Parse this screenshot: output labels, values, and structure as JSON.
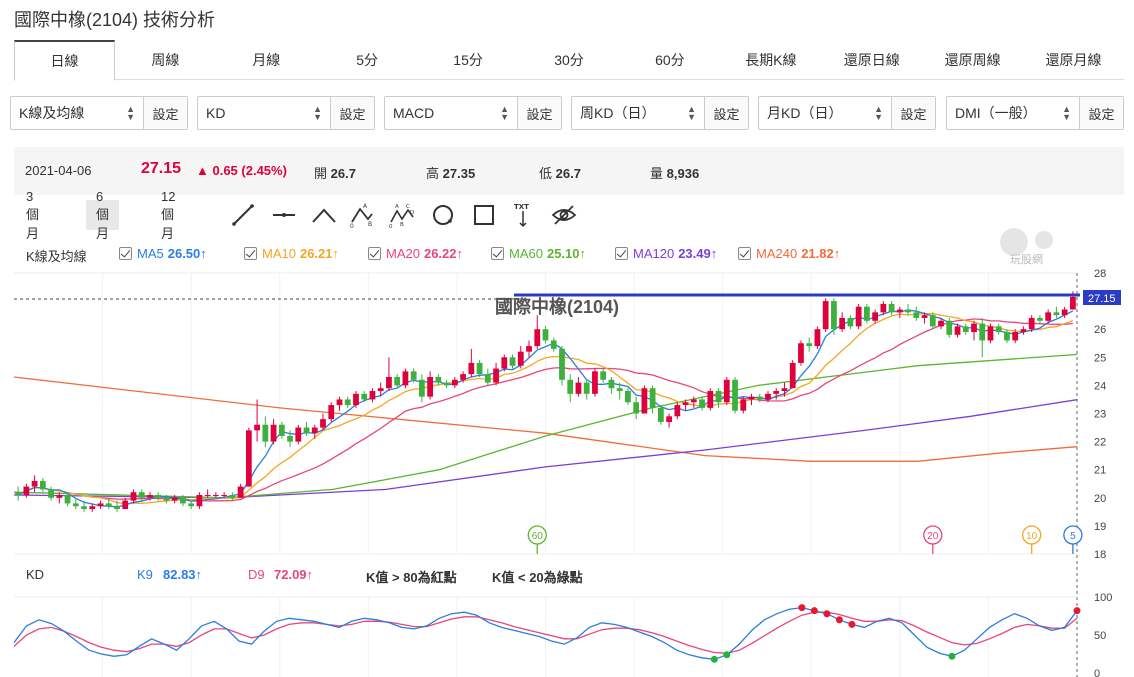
{
  "title": "國際中橡(2104) 技術分析",
  "tabs": [
    "日線",
    "周線",
    "月線",
    "5分",
    "15分",
    "30分",
    "60分",
    "長期K線",
    "還原日線",
    "還原周線",
    "還原月線"
  ],
  "selectors": [
    {
      "value": "K線及均線",
      "button": "設定"
    },
    {
      "value": "KD",
      "button": "設定"
    },
    {
      "value": "MACD",
      "button": "設定"
    },
    {
      "value": "周KD（日）",
      "button": "設定"
    },
    {
      "value": "月KD（日）",
      "button": "設定"
    },
    {
      "value": "DMI（一般）",
      "button": "設定"
    }
  ],
  "quote": {
    "date": "2021-04-06",
    "price": "27.15",
    "change": "▲ 0.65 (2.45%)",
    "open_label": "開",
    "open": "26.7",
    "high_label": "高",
    "high": "27.35",
    "low_label": "低",
    "low": "26.7",
    "vol_label": "量",
    "vol": "8,936"
  },
  "periods": [
    "3 個月",
    "6 個月",
    "12 個月"
  ],
  "drawing_tools": [
    "line-tool-icon",
    "horizontal-line-tool-icon",
    "angle-tool-icon",
    "abc-pattern-tool-icon",
    "abcd-pattern-tool-icon",
    "circle-tool-icon",
    "rectangle-tool-icon",
    "text-tool-icon",
    "hide-drawings-icon"
  ],
  "text_tool_label": "TXT",
  "pattern_labels": {
    "a": "A",
    "b": "B",
    "c": "C",
    "d": "D",
    "zero": "0"
  },
  "ma_legend": {
    "name": "K線及均線",
    "items": [
      {
        "label": "MA5",
        "value": "26.50↑",
        "color": "#2a7de1"
      },
      {
        "label": "MA10",
        "value": "26.21↑",
        "color": "#f5a623"
      },
      {
        "label": "MA20",
        "value": "26.22↑",
        "color": "#e8457c"
      },
      {
        "label": "MA60",
        "value": "25.10↑",
        "color": "#5cb531"
      },
      {
        "label": "MA120",
        "value": "23.49↑",
        "color": "#7b3fd6"
      },
      {
        "label": "MA240",
        "value": "21.82↑",
        "color": "#f26b3a"
      }
    ]
  },
  "watermark": "玩股網",
  "chart_title": "國際中橡(2104)",
  "last_price_tag": "27.15",
  "colors": {
    "up": "#e0003c",
    "down": "#3db03d",
    "price_line": "#2b3cc4"
  },
  "chart_data": [
    {
      "type": "candlestick",
      "title": "國際中橡(2104)",
      "ylim": [
        18,
        28
      ],
      "y_ticks": [
        "28",
        "27",
        "26",
        "25",
        "24",
        "23",
        "22",
        "21",
        "20",
        "19",
        "18"
      ],
      "ohlc": [
        [
          20.2,
          20.4,
          19.9,
          20.1
        ],
        [
          20.1,
          20.5,
          20.0,
          20.4
        ],
        [
          20.4,
          20.8,
          20.2,
          20.6
        ],
        [
          20.6,
          20.7,
          20.2,
          20.3
        ],
        [
          20.3,
          20.4,
          19.9,
          20.0
        ],
        [
          20.0,
          20.2,
          19.8,
          20.1
        ],
        [
          20.1,
          20.2,
          19.7,
          19.8
        ],
        [
          19.8,
          20.0,
          19.6,
          19.7
        ],
        [
          19.7,
          19.9,
          19.5,
          19.6
        ],
        [
          19.6,
          19.8,
          19.5,
          19.7
        ],
        [
          19.7,
          19.9,
          19.6,
          19.8
        ],
        [
          19.8,
          20.0,
          19.6,
          19.7
        ],
        [
          19.7,
          19.9,
          19.5,
          19.6
        ],
        [
          19.6,
          20.0,
          19.6,
          19.9
        ],
        [
          19.9,
          20.3,
          19.8,
          20.2
        ],
        [
          20.2,
          20.3,
          19.9,
          20.0
        ],
        [
          20.0,
          20.2,
          19.9,
          20.1
        ],
        [
          20.1,
          20.2,
          19.9,
          20.0
        ],
        [
          20.0,
          20.1,
          19.8,
          19.9
        ],
        [
          19.9,
          20.1,
          19.8,
          20.0
        ],
        [
          20.0,
          20.1,
          19.7,
          19.8
        ],
        [
          19.8,
          19.9,
          19.6,
          19.7
        ],
        [
          19.7,
          20.2,
          19.6,
          20.1
        ],
        [
          20.1,
          20.3,
          20.0,
          20.1
        ],
        [
          20.1,
          20.2,
          20.0,
          20.1
        ],
        [
          20.1,
          20.2,
          20.0,
          20.1
        ],
        [
          20.1,
          20.2,
          19.9,
          20.0
        ],
        [
          20.0,
          20.5,
          20.0,
          20.4
        ],
        [
          20.4,
          22.5,
          20.4,
          22.4
        ],
        [
          22.4,
          23.5,
          22.0,
          22.6
        ],
        [
          22.6,
          22.9,
          21.8,
          22.0
        ],
        [
          22.0,
          22.8,
          21.9,
          22.6
        ],
        [
          22.6,
          22.7,
          22.1,
          22.2
        ],
        [
          22.2,
          22.4,
          21.8,
          22.0
        ],
        [
          22.0,
          22.6,
          21.9,
          22.5
        ],
        [
          22.5,
          22.7,
          22.2,
          22.3
        ],
        [
          22.3,
          22.6,
          22.1,
          22.5
        ],
        [
          22.5,
          23.0,
          22.4,
          22.8
        ],
        [
          22.8,
          23.4,
          22.7,
          23.3
        ],
        [
          23.3,
          23.6,
          23.1,
          23.5
        ],
        [
          23.5,
          23.6,
          23.2,
          23.3
        ],
        [
          23.3,
          23.8,
          23.2,
          23.7
        ],
        [
          23.7,
          23.8,
          23.4,
          23.5
        ],
        [
          23.5,
          23.9,
          23.4,
          23.8
        ],
        [
          23.8,
          24.1,
          23.6,
          23.9
        ],
        [
          23.9,
          25.0,
          23.8,
          24.3
        ],
        [
          24.3,
          24.4,
          23.9,
          24.0
        ],
        [
          24.0,
          24.6,
          23.9,
          24.5
        ],
        [
          24.5,
          24.6,
          24.1,
          24.2
        ],
        [
          24.2,
          24.4,
          23.4,
          23.6
        ],
        [
          23.6,
          24.5,
          23.5,
          24.3
        ],
        [
          24.3,
          24.4,
          24.0,
          24.1
        ],
        [
          24.1,
          24.2,
          23.9,
          24.0
        ],
        [
          24.0,
          24.3,
          23.9,
          24.2
        ],
        [
          24.2,
          24.5,
          24.1,
          24.4
        ],
        [
          24.4,
          25.3,
          24.3,
          24.8
        ],
        [
          24.8,
          24.9,
          24.3,
          24.4
        ],
        [
          24.4,
          24.6,
          24.0,
          24.1
        ],
        [
          24.1,
          24.8,
          24.0,
          24.6
        ],
        [
          24.6,
          25.1,
          24.5,
          25.0
        ],
        [
          25.0,
          25.1,
          24.6,
          24.7
        ],
        [
          24.7,
          25.4,
          24.6,
          25.2
        ],
        [
          25.2,
          25.6,
          25.0,
          25.4
        ],
        [
          25.4,
          26.5,
          25.3,
          26.0
        ],
        [
          26.0,
          26.1,
          25.5,
          25.6
        ],
        [
          25.6,
          25.7,
          25.2,
          25.3
        ],
        [
          25.3,
          25.4,
          24.0,
          24.2
        ],
        [
          24.2,
          24.4,
          23.4,
          23.7
        ],
        [
          23.7,
          24.3,
          23.6,
          24.1
        ],
        [
          24.1,
          24.2,
          23.5,
          23.7
        ],
        [
          23.7,
          24.6,
          23.6,
          24.5
        ],
        [
          24.5,
          24.6,
          24.1,
          24.2
        ],
        [
          24.2,
          24.3,
          23.7,
          23.9
        ],
        [
          23.9,
          24.1,
          23.5,
          23.8
        ],
        [
          23.8,
          23.9,
          23.3,
          23.4
        ],
        [
          23.4,
          23.6,
          22.8,
          23.0
        ],
        [
          23.0,
          24.0,
          23.0,
          23.9
        ],
        [
          23.9,
          24.0,
          23.0,
          23.2
        ],
        [
          23.2,
          23.3,
          22.6,
          22.7
        ],
        [
          22.7,
          23.0,
          22.5,
          22.9
        ],
        [
          22.9,
          23.4,
          22.8,
          23.3
        ],
        [
          23.3,
          23.5,
          23.1,
          23.4
        ],
        [
          23.4,
          23.6,
          23.2,
          23.5
        ],
        [
          23.5,
          23.6,
          23.1,
          23.2
        ],
        [
          23.2,
          23.9,
          23.1,
          23.8
        ],
        [
          23.8,
          23.9,
          23.2,
          23.4
        ],
        [
          23.4,
          24.3,
          23.3,
          24.2
        ],
        [
          24.2,
          24.3,
          23.0,
          23.1
        ],
        [
          23.1,
          23.6,
          23.0,
          23.5
        ],
        [
          23.5,
          23.7,
          23.3,
          23.6
        ],
        [
          23.6,
          23.7,
          23.4,
          23.5
        ],
        [
          23.5,
          23.8,
          23.4,
          23.7
        ],
        [
          23.7,
          23.9,
          23.5,
          23.8
        ],
        [
          23.8,
          24.1,
          23.6,
          23.9
        ],
        [
          23.9,
          24.9,
          23.9,
          24.8
        ],
        [
          24.8,
          25.6,
          24.7,
          25.5
        ],
        [
          25.5,
          25.7,
          25.2,
          25.4
        ],
        [
          25.4,
          26.1,
          25.3,
          26.0
        ],
        [
          26.0,
          27.1,
          25.9,
          27.0
        ],
        [
          27.0,
          27.1,
          25.8,
          26.0
        ],
        [
          26.0,
          26.6,
          25.9,
          26.4
        ],
        [
          26.4,
          26.5,
          26.0,
          26.1
        ],
        [
          26.1,
          26.9,
          26.0,
          26.8
        ],
        [
          26.8,
          26.9,
          26.2,
          26.3
        ],
        [
          26.3,
          26.7,
          26.2,
          26.6
        ],
        [
          26.6,
          27.0,
          26.5,
          26.9
        ],
        [
          26.9,
          27.0,
          26.5,
          26.6
        ],
        [
          26.6,
          26.8,
          26.4,
          26.7
        ],
        [
          26.7,
          26.9,
          26.5,
          26.6
        ],
        [
          26.6,
          26.8,
          26.3,
          26.4
        ],
        [
          26.4,
          26.6,
          26.2,
          26.5
        ],
        [
          26.5,
          26.6,
          26.0,
          26.1
        ],
        [
          26.1,
          26.4,
          26.0,
          26.3
        ],
        [
          26.3,
          26.4,
          25.7,
          25.8
        ],
        [
          25.8,
          26.2,
          25.7,
          26.1
        ],
        [
          26.1,
          26.2,
          25.8,
          25.9
        ],
        [
          25.9,
          26.3,
          25.6,
          26.2
        ],
        [
          26.2,
          26.4,
          25.0,
          25.6
        ],
        [
          25.6,
          26.2,
          25.5,
          26.1
        ],
        [
          26.1,
          26.2,
          25.8,
          25.9
        ],
        [
          25.9,
          26.0,
          25.5,
          25.6
        ],
        [
          25.6,
          26.0,
          25.5,
          25.9
        ],
        [
          25.9,
          26.1,
          25.8,
          26.0
        ],
        [
          26.0,
          26.5,
          25.9,
          26.4
        ],
        [
          26.4,
          26.5,
          26.2,
          26.3
        ],
        [
          26.3,
          26.7,
          26.2,
          26.6
        ],
        [
          26.6,
          26.8,
          26.4,
          26.5
        ],
        [
          26.5,
          26.8,
          26.4,
          26.7
        ],
        [
          26.7,
          27.35,
          26.7,
          27.15
        ]
      ],
      "ma240": [
        [
          0,
          24.3
        ],
        [
          0.25,
          23.2
        ],
        [
          0.5,
          22.3
        ],
        [
          0.65,
          21.5
        ],
        [
          0.75,
          21.3
        ],
        [
          0.85,
          21.3
        ],
        [
          0.93,
          21.6
        ],
        [
          1.0,
          21.82
        ]
      ],
      "ma120": [
        [
          0,
          20.1
        ],
        [
          0.2,
          20.0
        ],
        [
          0.35,
          20.3
        ],
        [
          0.5,
          21.1
        ],
        [
          0.65,
          21.7
        ],
        [
          0.8,
          22.4
        ],
        [
          0.9,
          22.9
        ],
        [
          1.0,
          23.49
        ]
      ],
      "ma60": [
        [
          0,
          20.2
        ],
        [
          0.2,
          20.0
        ],
        [
          0.3,
          20.3
        ],
        [
          0.4,
          21.0
        ],
        [
          0.5,
          22.2
        ],
        [
          0.6,
          23.2
        ],
        [
          0.7,
          24.0
        ],
        [
          0.85,
          24.7
        ],
        [
          1.0,
          25.1
        ]
      ],
      "markers": [
        {
          "label": "60",
          "index": 63,
          "color": "#5cb531"
        },
        {
          "label": "20",
          "index": 111,
          "color": "#e8457c"
        },
        {
          "label": "10",
          "index": 123,
          "color": "#f5a623"
        },
        {
          "label": "5",
          "index": 128,
          "color": "#2a7de1"
        }
      ]
    },
    {
      "type": "line",
      "title": "KD",
      "ylim": [
        0,
        100
      ],
      "y_ticks": [
        "100",
        "50",
        "0"
      ],
      "series": [
        {
          "name": "K9",
          "values": [
            40,
            62,
            70,
            65,
            55,
            42,
            30,
            25,
            22,
            24,
            35,
            45,
            38,
            30,
            45,
            62,
            68,
            58,
            42,
            38,
            55,
            68,
            72,
            70,
            68,
            64,
            60,
            68,
            72,
            70,
            66,
            60,
            58,
            62,
            72,
            78,
            80,
            76,
            66,
            60,
            56,
            52,
            48,
            42,
            38,
            46,
            60,
            66,
            64,
            60,
            54,
            48,
            40,
            30,
            24,
            20,
            18,
            24,
            38,
            56,
            70,
            78,
            84,
            86,
            82,
            78,
            70,
            64,
            60,
            68,
            72,
            66,
            50,
            34,
            26,
            22,
            30,
            45,
            60,
            70,
            78,
            72,
            62,
            56,
            60,
            82
          ],
          "color": "#2a7de1"
        },
        {
          "name": "D9",
          "values": [
            35,
            50,
            58,
            60,
            55,
            48,
            40,
            34,
            30,
            28,
            32,
            38,
            38,
            35,
            40,
            50,
            58,
            58,
            52,
            46,
            50,
            58,
            64,
            66,
            66,
            64,
            62,
            64,
            68,
            68,
            67,
            64,
            61,
            61,
            66,
            71,
            74,
            74,
            70,
            66,
            61,
            57,
            53,
            49,
            45,
            45,
            51,
            57,
            59,
            59,
            57,
            53,
            48,
            42,
            36,
            31,
            27,
            26,
            30,
            39,
            49,
            59,
            68,
            76,
            80,
            80,
            77,
            72,
            68,
            68,
            70,
            69,
            62,
            54,
            47,
            40,
            37,
            39,
            45,
            52,
            60,
            64,
            62,
            59,
            59,
            72
          ],
          "color": "#e8457c"
        }
      ],
      "red_dots": [
        63,
        64,
        65,
        66,
        67,
        85
      ],
      "green_dots": [
        56,
        57,
        75
      ]
    }
  ],
  "kd_legend": {
    "title": "KD",
    "k_label": "K9",
    "k_value": "82.83↑",
    "d_label": "D9",
    "d_value": "72.09↑",
    "note1": "K值 > 80為紅點",
    "note2": "K值 < 20為綠點"
  }
}
